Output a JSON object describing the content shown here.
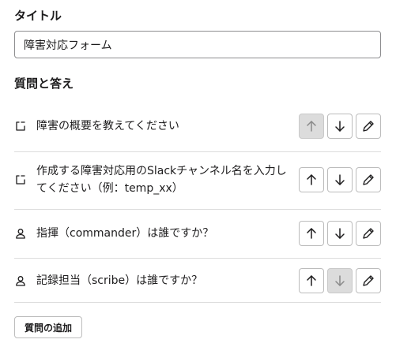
{
  "form": {
    "title_label": "タイトル",
    "title_value": "障害対応フォーム",
    "qa_label": "質問と答え",
    "add_button_label": "質問の追加"
  },
  "questions": [
    {
      "text": "障害の概要を教えてください",
      "icon": "text-bracket-icon",
      "up_disabled": true,
      "down_disabled": false
    },
    {
      "text": "作成する障害対応用のSlackチャンネル名を入力してください（例：temp_xx）",
      "icon": "text-bracket-icon",
      "up_disabled": false,
      "down_disabled": false
    },
    {
      "text": "指揮（commander）は誰ですか？",
      "icon": "person-icon",
      "up_disabled": false,
      "down_disabled": false
    },
    {
      "text": "記録担当（scribe）は誰ですか？",
      "icon": "person-icon",
      "up_disabled": false,
      "down_disabled": true
    }
  ],
  "colors": {
    "text": "#1d1c1d",
    "border": "#bcbcbc",
    "divider": "#dddddd",
    "disabled_bg": "#dcdcdc",
    "disabled_icon": "#8a8a8a"
  }
}
